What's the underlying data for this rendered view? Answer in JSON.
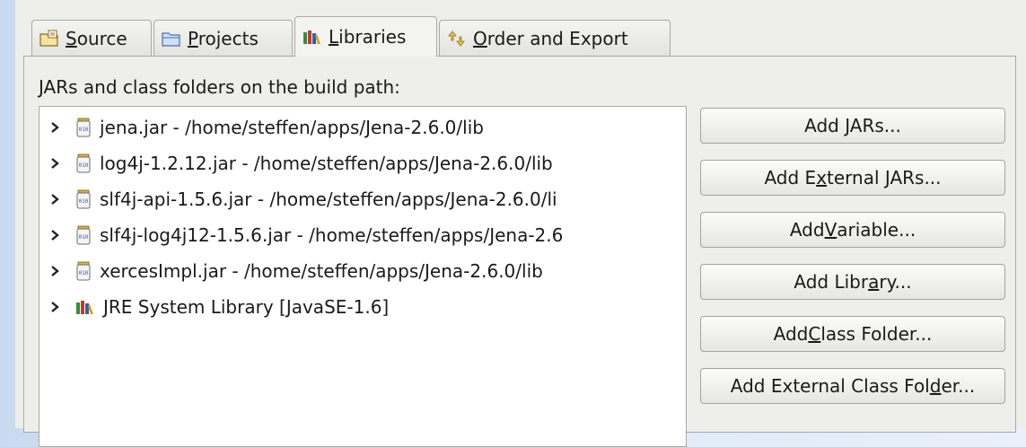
{
  "tabs": [
    {
      "pre": "",
      "mn": "S",
      "post": "ource",
      "icon": "source-folder-icon"
    },
    {
      "pre": "",
      "mn": "P",
      "post": "rojects",
      "icon": "projects-folder-icon"
    },
    {
      "pre": "",
      "mn": "L",
      "post": "ibraries",
      "icon": "libraries-icon",
      "active": true
    },
    {
      "pre": "",
      "mn": "O",
      "post": "rder and Export",
      "icon": "order-export-icon"
    }
  ],
  "heading": "JARs and class folders on the build path:",
  "entries": [
    {
      "label": "jena.jar - /home/steffen/apps/Jena-2.6.0/lib",
      "icon": "jar-icon"
    },
    {
      "label": "log4j-1.2.12.jar - /home/steffen/apps/Jena-2.6.0/lib",
      "icon": "jar-icon"
    },
    {
      "label": "slf4j-api-1.5.6.jar - /home/steffen/apps/Jena-2.6.0/li",
      "icon": "jar-icon"
    },
    {
      "label": "slf4j-log4j12-1.5.6.jar - /home/steffen/apps/Jena-2.6",
      "icon": "jar-icon"
    },
    {
      "label": "xercesImpl.jar - /home/steffen/apps/Jena-2.6.0/lib",
      "icon": "jar-icon"
    },
    {
      "label": "JRE System Library [JavaSE-1.6]",
      "icon": "library-icon"
    }
  ],
  "buttons": [
    {
      "pre": "Add JARs...",
      "mn": "",
      "post": ""
    },
    {
      "pre": "Add E",
      "mn": "x",
      "post": "ternal JARs..."
    },
    {
      "pre": "Add ",
      "mn": "V",
      "post": "ariable..."
    },
    {
      "pre": "Add Libr",
      "mn": "a",
      "post": "ry..."
    },
    {
      "pre": "Add ",
      "mn": "C",
      "post": "lass Folder..."
    },
    {
      "pre": "Add External Class Fol",
      "mn": "d",
      "post": "er..."
    }
  ]
}
